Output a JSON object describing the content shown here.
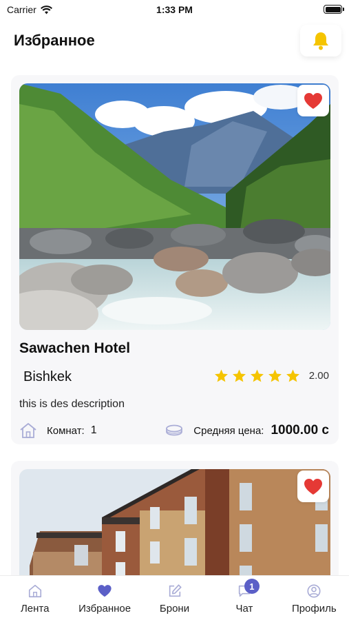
{
  "status_bar": {
    "carrier": "Carrier",
    "time": "1:33 PM"
  },
  "header": {
    "title": "Избранное",
    "bell_icon": "bell-icon",
    "accent": "#f5c400"
  },
  "cards": [
    {
      "name": "Sawachen Hotel",
      "city": "Bishkek",
      "rating_stars": 5,
      "rating_value": "2.00",
      "description": "this is des description",
      "rooms_label": "Комнат:",
      "rooms_value": "1",
      "price_label": "Средняя цена:",
      "price_value": "1000.00 с",
      "favorite": true
    },
    {
      "favorite": true
    }
  ],
  "tabs": [
    {
      "label": "Лента",
      "icon": "home-icon"
    },
    {
      "label": "Избранное",
      "icon": "heart-icon",
      "active": true
    },
    {
      "label": "Брони",
      "icon": "edit-icon"
    },
    {
      "label": "Чат",
      "icon": "chat-icon",
      "badge": "1"
    },
    {
      "label": "Профиль",
      "icon": "profile-icon"
    }
  ],
  "colors": {
    "heart": "#e53935",
    "star": "#f5c400",
    "tab_icon": "#a9acd6",
    "tab_active": "#5b5fc7"
  }
}
